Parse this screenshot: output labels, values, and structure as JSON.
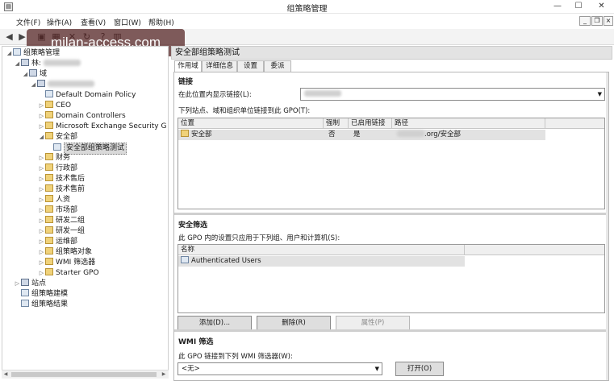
{
  "window": {
    "title": "组策略管理"
  },
  "menu": [
    {
      "label": "文件(F)"
    },
    {
      "label": "操作(A)"
    },
    {
      "label": "查看(V)"
    },
    {
      "label": "窗口(W)"
    },
    {
      "label": "帮助(H)"
    }
  ],
  "watermark": "milan-access.com",
  "tree": {
    "root": "组策略管理",
    "forest": "林:",
    "domains": "域",
    "items": [
      "Default Domain Policy",
      "CEO",
      "Domain Controllers",
      "Microsoft Exchange Security G",
      "安全部",
      "安全部组策略测试",
      "财务",
      "行政部",
      "技术售后",
      "技术售前",
      "人资",
      "市场部",
      "研发二组",
      "研发一组",
      "运维部",
      "组策略对象",
      "WMI 筛选器",
      "Starter GPO",
      "站点",
      "组策略建模",
      "组策略结果"
    ]
  },
  "detail": {
    "header": "安全部组策略测试",
    "tabs": [
      "作用域",
      "详细信息",
      "设置",
      "委派"
    ],
    "links": {
      "title": "链接",
      "show_label": "在此位置内显示链接(L):",
      "list_label": "下列站点、域和组织单位链接到此 GPO(T):",
      "columns": [
        "位置",
        "强制",
        "已启用链接",
        "路径"
      ],
      "rows": [
        {
          "location": "安全部",
          "enforced": "否",
          "enabled": "是",
          "path": ".org/安全部"
        }
      ]
    },
    "security": {
      "title": "安全筛选",
      "desc": "此 GPO 内的设置只应用于下列组、用户和计算机(S):",
      "column": "名称",
      "rows": [
        "Authenticated Users"
      ],
      "buttons": {
        "add": "添加(D)...",
        "remove": "删除(R)",
        "properties": "属性(P)"
      }
    },
    "wmi": {
      "title": "WMI 筛选",
      "desc": "此 GPO 链接到下列 WMI 筛选器(W):",
      "value": "<无>",
      "open": "打开(O)"
    }
  }
}
